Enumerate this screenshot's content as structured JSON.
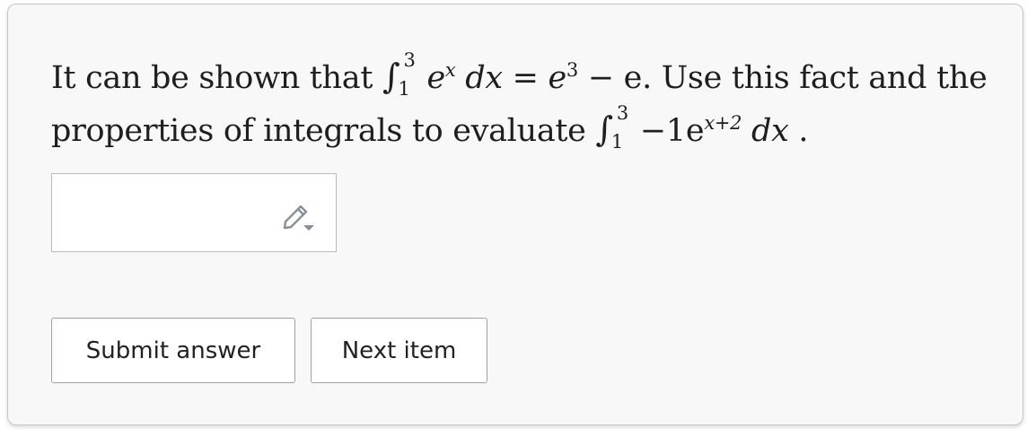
{
  "question": {
    "line1_text_a": "It can be shown that",
    "line1_integral_upper": "3",
    "line1_integral_lower": "1",
    "line1_integrand_base": "e",
    "line1_integrand_exp": "x",
    "line1_dx": "dx",
    "line1_equals": "=",
    "line1_rhs_base": "e",
    "line1_rhs_exp": "3",
    "line1_rhs_rest": "− e.",
    "line1_text_b": "Use this fact and the",
    "line2_text_a": "properties of integrals to evaluate",
    "line2_integral_upper": "3",
    "line2_integral_lower": "1",
    "line2_coef": "−1e",
    "line2_exp": "x+2",
    "line2_dx": "dx",
    "line2_end": "."
  },
  "answer": {
    "value": "",
    "icon": "pencil-icon"
  },
  "buttons": {
    "submit_label": "Submit answer",
    "next_label": "Next item"
  },
  "colors": {
    "card_background": "#f8f8f9",
    "border": "#c4c8cc",
    "text": "#1e1e1e",
    "icon": "#8a8f94"
  }
}
